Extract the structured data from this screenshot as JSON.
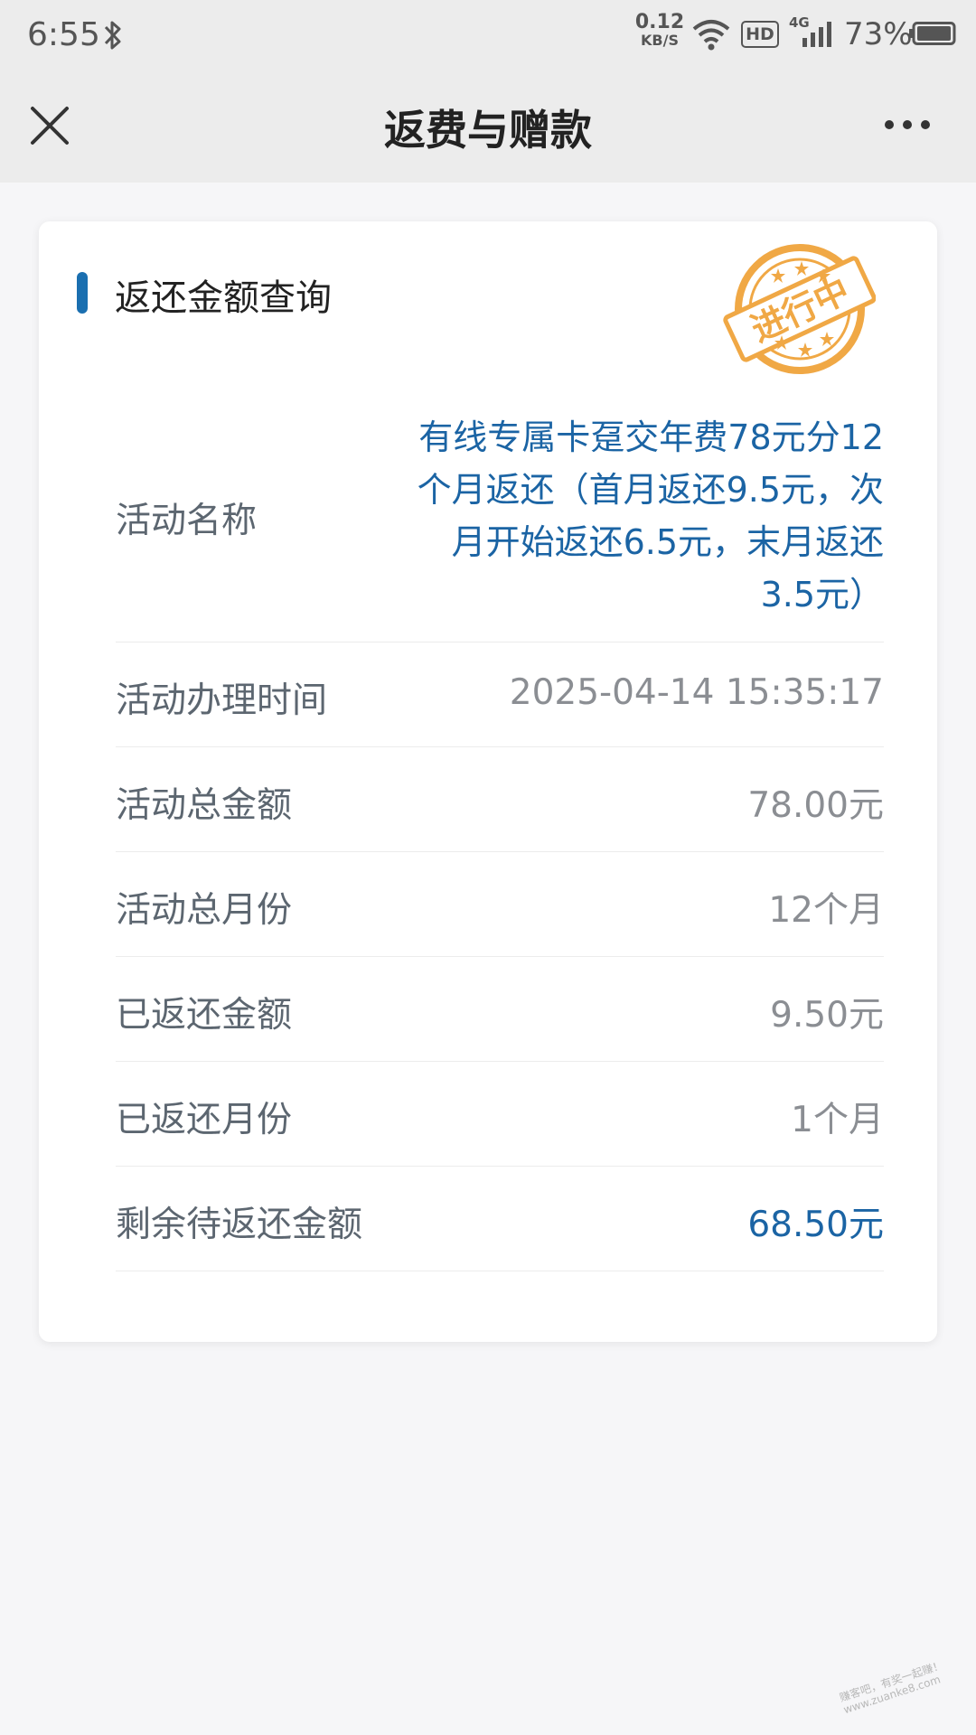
{
  "status_bar": {
    "time": "6:55",
    "net_speed_value": "0.12",
    "net_speed_unit": "KB/S",
    "hd_label": "HD",
    "network_type": "4G",
    "battery_percent": "73%"
  },
  "nav": {
    "title": "返费与赠款"
  },
  "card": {
    "title": "返还金额查询",
    "stamp_text": "进行中",
    "rows": [
      {
        "label": "活动名称",
        "value": "有线专属卡趸交年费78元分12个月返还（首月返还9.5元，次月开始返还6.5元，末月返还3.5元）"
      },
      {
        "label": "活动办理时间",
        "value": "2025-04-14 15:35:17"
      },
      {
        "label": "活动总金额",
        "value": "78.00元"
      },
      {
        "label": "活动总月份",
        "value": "12个月"
      },
      {
        "label": "已返还金额",
        "value": "9.50元"
      },
      {
        "label": "已返还月份",
        "value": "1个月"
      },
      {
        "label": "剩余待返还金额",
        "value": "68.50元"
      }
    ]
  },
  "watermark": {
    "line1": "赚客吧，有奖一起赚！",
    "line2": "www.zuanke8.com"
  },
  "colors": {
    "accent_blue": "#1a6fb0",
    "value_blue": "#1b64a4",
    "stamp_orange": "#f0a845"
  }
}
